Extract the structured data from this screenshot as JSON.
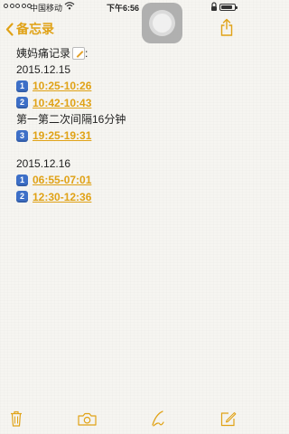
{
  "status_bar": {
    "signal_filled": 0,
    "signal_total": 5,
    "carrier": "中国移动",
    "time": "下午6:56",
    "battery_level": 0.85
  },
  "nav": {
    "back_label": "备忘录",
    "accent_color": "#e0a216"
  },
  "note": {
    "title": "姨妈痛记录",
    "title_suffix": ":",
    "sections": [
      {
        "date": "2015.12.15",
        "entries": [
          {
            "num": "1",
            "time": "10:25-10:26"
          },
          {
            "num": "2",
            "time": "10:42-10:43"
          }
        ],
        "comment": "第一第二次间隔16分钟",
        "extra": [
          {
            "num": "3",
            "time": "19:25-19:31"
          }
        ]
      },
      {
        "date": "2015.12.16",
        "entries": [
          {
            "num": "1",
            "time": "06:55-07:01"
          },
          {
            "num": "2",
            "time": "12:30-12:36"
          }
        ]
      }
    ]
  },
  "icons": {
    "back": "chevron-left-icon",
    "share": "share-icon",
    "trash": "trash-icon",
    "camera": "camera-icon",
    "sketch": "sketch-icon",
    "compose": "compose-icon",
    "title_emoji": "memo-pencil-icon"
  }
}
